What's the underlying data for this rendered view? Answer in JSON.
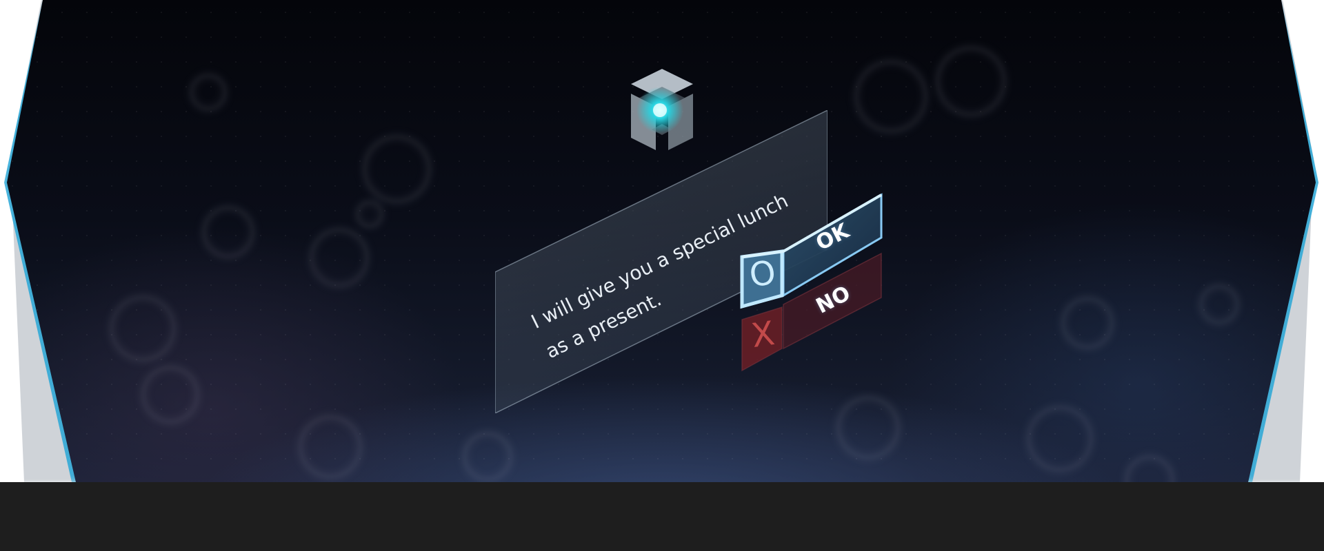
{
  "dialog": {
    "message_lines": [
      "I will give you a special lunch",
      "as a present."
    ]
  },
  "buttons": {
    "ok": {
      "icon": "O",
      "label": "OK"
    },
    "no": {
      "icon": "X",
      "label": "NO"
    }
  },
  "colors": {
    "accent_cyan": "#29d3e0",
    "ok_border": "#8fd4ff",
    "no_tint": "#5a1c28",
    "no_glyph": "#c24a4a",
    "viewport_glow": "#28a6d6"
  },
  "icons": {
    "cube": "glowing-cube-icon"
  }
}
